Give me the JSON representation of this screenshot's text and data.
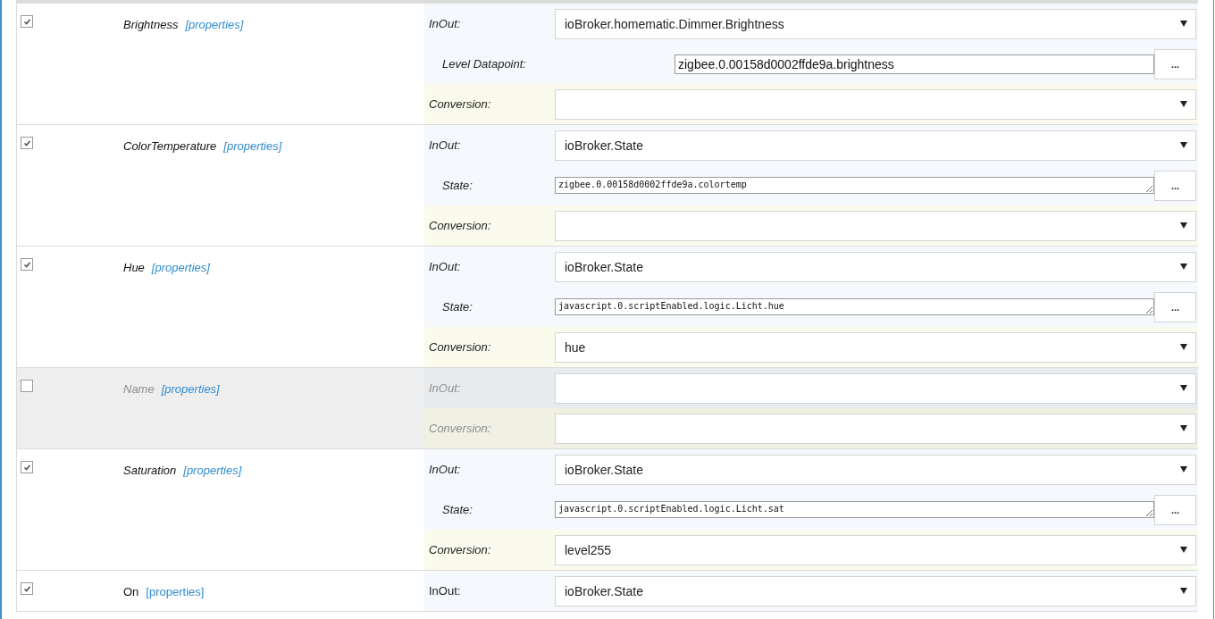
{
  "channels": [
    {
      "name": "Brightness",
      "enabled": true,
      "italic": true,
      "link": "[properties]",
      "inout_label": "InOut:",
      "inout_value": "ioBroker.homematic.Dimmer.Brightness",
      "datapoint": {
        "kind": "input",
        "label": "Level Datapoint:",
        "value": "zigbee.0.00158d0002ffde9a.brightness",
        "button": "..."
      },
      "conversion_label": "Conversion:"
    },
    {
      "name": "ColorTemperature",
      "enabled": true,
      "italic": true,
      "link": "[properties]",
      "inout_label": "InOut:",
      "inout_value": "ioBroker.State",
      "datapoint": {
        "kind": "textarea",
        "label": "State:",
        "value": "zigbee.0.00158d0002ffde9a.colortemp",
        "button": "..."
      },
      "conversion_label": "Conversion:"
    },
    {
      "name": "Hue",
      "enabled": true,
      "italic": true,
      "link": "[properties]",
      "inout_label": "InOut:",
      "inout_value": "ioBroker.State",
      "datapoint": {
        "kind": "textarea",
        "label": "State:",
        "value": "javascript.0.scriptEnabled.logic.Licht.hue",
        "button": "..."
      },
      "conversion_label": "Conversion:",
      "conversion_value": "hue"
    },
    {
      "name": "Name",
      "enabled": false,
      "italic": true,
      "link": "[properties]",
      "inout_label": "InOut:",
      "conversion_label": "Conversion:"
    },
    {
      "name": "Saturation",
      "enabled": true,
      "italic": true,
      "link": "[properties]",
      "inout_label": "InOut:",
      "inout_value": "ioBroker.State",
      "datapoint": {
        "kind": "textarea",
        "label": "State:",
        "value": "javascript.0.scriptEnabled.logic.Licht.sat",
        "button": "..."
      },
      "conversion_label": "Conversion:",
      "conversion_value": "level255"
    },
    {
      "name": "On",
      "enabled": true,
      "italic": false,
      "link": "[properties]",
      "inout_label": "InOut:",
      "inout_value": "ioBroker.State"
    }
  ]
}
